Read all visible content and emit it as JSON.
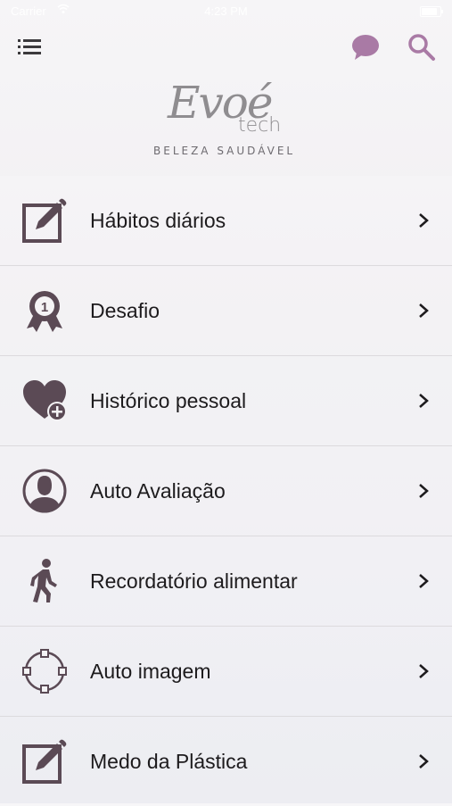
{
  "status_bar": {
    "carrier": "Carrier",
    "time": "4:23 PM"
  },
  "header": {
    "menu_icon": "hamburger-menu-icon",
    "chat_icon": "chat-bubble-icon",
    "search_icon": "search-icon",
    "accent_color": "#a97aa5"
  },
  "logo": {
    "script": "Evoé",
    "tech": "tech",
    "subtitle": "BELEZA SAUDÁVEL"
  },
  "menu": {
    "items": [
      {
        "label": "Hábitos diários",
        "icon": "edit-square-icon"
      },
      {
        "label": "Desafio",
        "icon": "award-ribbon-icon"
      },
      {
        "label": "Histórico pessoal",
        "icon": "heart-plus-icon"
      },
      {
        "label": "Auto Avaliação",
        "icon": "user-circle-icon"
      },
      {
        "label": "Recordatório alimentar",
        "icon": "walking-person-icon"
      },
      {
        "label": "Auto imagem",
        "icon": "shape-nodes-icon"
      },
      {
        "label": "Medo da Plástica",
        "icon": "edit-square-icon"
      }
    ],
    "icon_color": "#5b4a55"
  }
}
